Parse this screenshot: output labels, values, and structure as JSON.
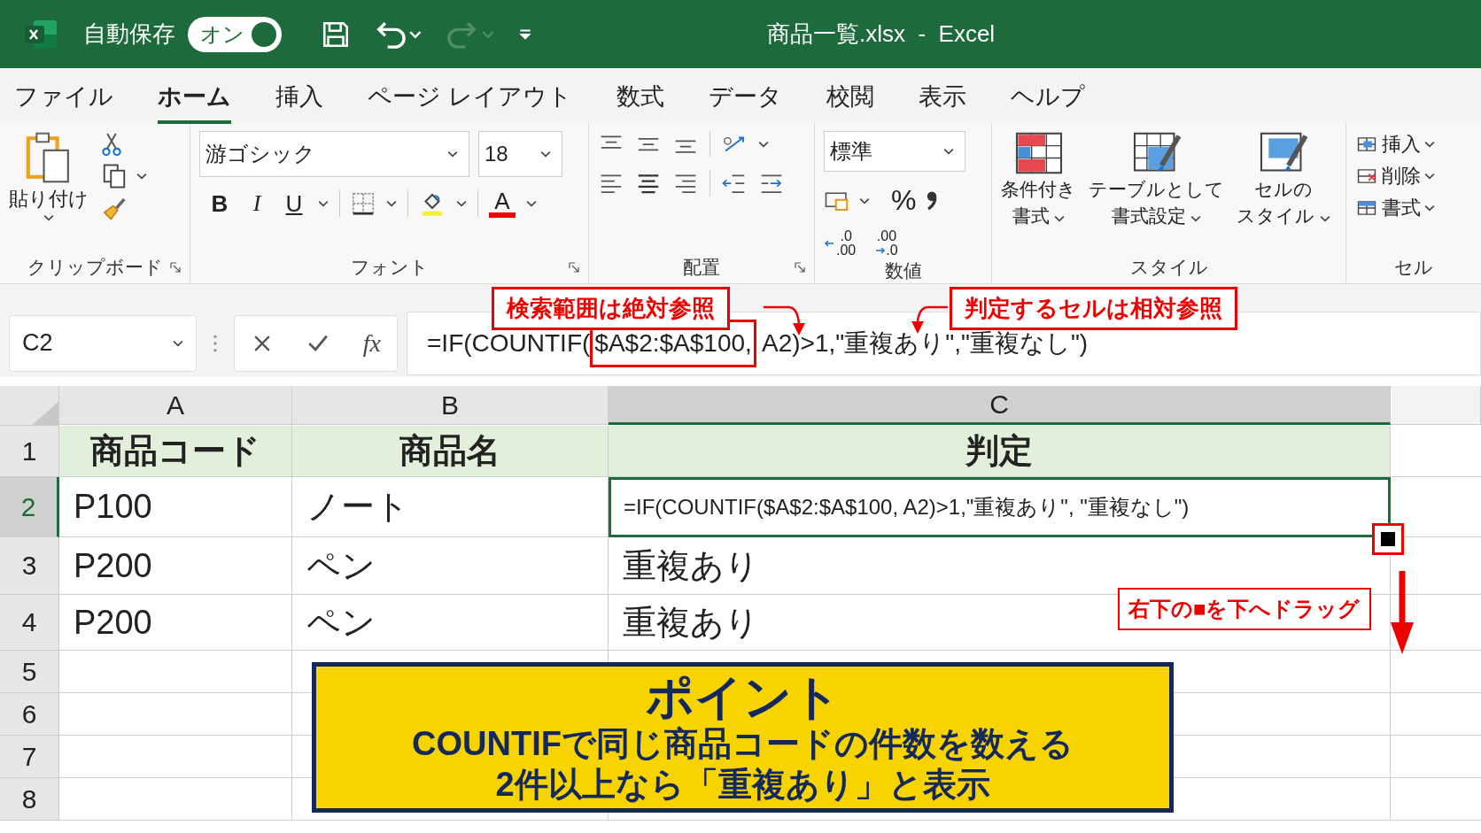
{
  "title_bar": {
    "autosave_label": "自動保存",
    "autosave_toggle": {
      "label": "オン",
      "on": true
    },
    "quick_access": [
      {
        "kind": "save",
        "disabled": false
      },
      {
        "kind": "undo",
        "disabled": false
      },
      {
        "kind": "redo",
        "disabled": true
      },
      {
        "kind": "customize",
        "disabled": false
      }
    ],
    "title": "商品一覧.xlsx  -  Excel"
  },
  "ribbon_tabs": [
    {
      "label": "ファイル",
      "selected": false
    },
    {
      "label": "ホーム",
      "selected": true
    },
    {
      "label": "挿入",
      "selected": false
    },
    {
      "label": "ページ レイアウト",
      "selected": false
    },
    {
      "label": "数式",
      "selected": false
    },
    {
      "label": "データ",
      "selected": false
    },
    {
      "label": "校閲",
      "selected": false
    },
    {
      "label": "表示",
      "selected": false
    },
    {
      "label": "ヘルプ",
      "selected": false
    }
  ],
  "ribbon": {
    "clipboard": {
      "paste_label": "貼り付け",
      "group_label": "クリップボード"
    },
    "font": {
      "font_name": "游ゴシック",
      "font_size": "18",
      "bold": "B",
      "italic": "I",
      "underline": "U",
      "font_color": "A",
      "group_label": "フォント"
    },
    "alignment": {
      "group_label": "配置"
    },
    "number": {
      "format": "標準",
      "percent": "%",
      "increase_decimal": [
        ".0",
        ".00"
      ],
      "decrease_decimal": [
        ".00",
        ".0"
      ],
      "group_label": "数値"
    },
    "styles": {
      "buttons": [
        {
          "kind": "conditional",
          "lines": [
            "条件付き",
            "書式"
          ]
        },
        {
          "kind": "table",
          "lines": [
            "テーブルとして",
            "書式設定"
          ]
        },
        {
          "kind": "cell",
          "lines": [
            "セルの",
            "スタイル"
          ]
        }
      ],
      "group_label": "スタイル"
    },
    "cells": {
      "buttons": [
        {
          "kind": "insert",
          "label": "挿入"
        },
        {
          "kind": "delete",
          "label": "削除"
        },
        {
          "kind": "format",
          "label": "書式"
        }
      ],
      "group_label": "セル"
    }
  },
  "formula_bar": {
    "name_box": "C2",
    "fx": "fx",
    "formula_before": "=IF(COUNTIF(",
    "formula_highlight": "$A$2:$A$100,",
    "formula_after": " A2)>1,\"重複あり\",\"重複なし\")"
  },
  "sheet": {
    "columns": [
      {
        "label": "A",
        "selected": false
      },
      {
        "label": "B",
        "selected": false
      },
      {
        "label": "C",
        "selected": true
      }
    ],
    "rows": [
      {
        "number": "1",
        "kind": "header",
        "selected": false,
        "cells": [
          {
            "text": "商品コード",
            "selected": false
          },
          {
            "text": "商品名",
            "selected": false
          },
          {
            "text": "判定",
            "selected": false
          }
        ]
      },
      {
        "number": "2",
        "kind": "data",
        "selected": true,
        "cells": [
          {
            "text": "P100",
            "selected": false
          },
          {
            "text": "ノート",
            "selected": false
          },
          {
            "text": "=IF(COUNTIF($A$2:$A$100, A2)>1,\"重複あり\", \"重複なし\")",
            "selected": true
          }
        ]
      },
      {
        "number": "3",
        "kind": "data",
        "selected": false,
        "cells": [
          {
            "text": "P200",
            "selected": false
          },
          {
            "text": "ペン",
            "selected": false
          },
          {
            "text": "重複あり",
            "selected": false
          }
        ]
      },
      {
        "number": "4",
        "kind": "data",
        "selected": false,
        "cells": [
          {
            "text": "P200",
            "selected": false
          },
          {
            "text": "ペン",
            "selected": false
          },
          {
            "text": "重複あり",
            "selected": false
          }
        ]
      },
      {
        "number": "5",
        "kind": "empty",
        "selected": false,
        "cells": []
      },
      {
        "number": "6",
        "kind": "empty",
        "selected": false,
        "cells": []
      },
      {
        "number": "7",
        "kind": "empty",
        "selected": false,
        "cells": []
      },
      {
        "number": "8",
        "kind": "empty",
        "selected": false,
        "cells": []
      }
    ]
  },
  "annotations": {
    "absolute_note": "検索範囲は絶対参照",
    "relative_note": "判定するセルは相対参照",
    "drag_note": "右下の■を下へドラッグ"
  },
  "point_box": {
    "title": "ポイント",
    "lines": [
      "COUNTIFで同じ商品コードの件数を数える",
      "2件以上なら「重複あり」と表示"
    ]
  }
}
